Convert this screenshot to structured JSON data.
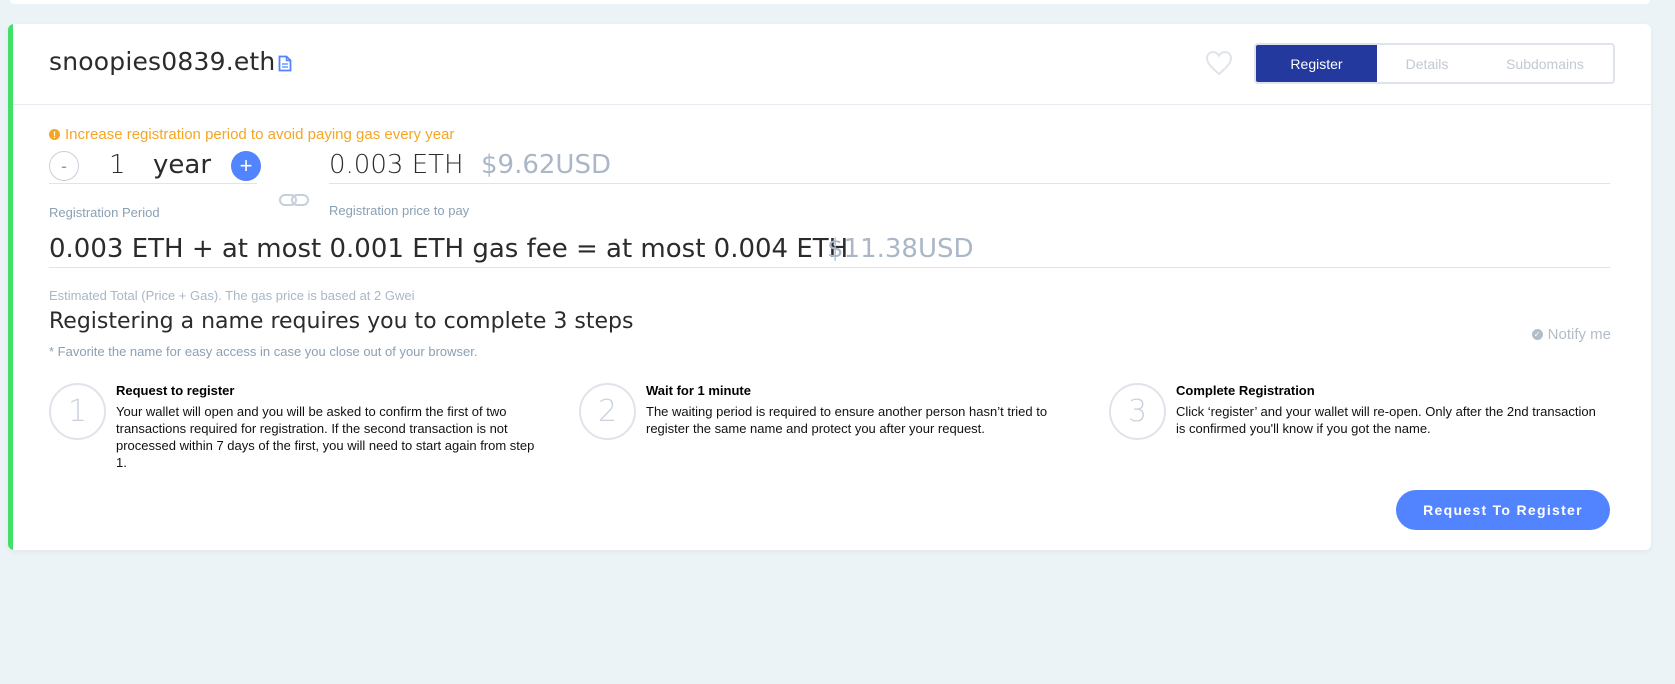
{
  "header": {
    "domain": "snoopies0839.eth",
    "tabs": [
      {
        "label": "Register",
        "active": true
      },
      {
        "label": "Details",
        "active": false
      },
      {
        "label": "Subdomains",
        "active": false
      }
    ]
  },
  "warning": "Increase registration period to avoid paying gas every year",
  "period": {
    "minus_label": "-",
    "value": "1",
    "unit": "year",
    "plus_label": "+",
    "label": "Registration Period"
  },
  "price": {
    "eth": "0.003 ETH",
    "usd": "$9.62USD",
    "label": "Registration price to pay"
  },
  "total": {
    "text": "0.003 ETH + at most 0.001 ETH gas fee = at most 0.004 ETH",
    "usd": "$11.38USD",
    "label": "Estimated Total (Price + Gas). The gas price is based at 2 Gwei"
  },
  "steps_section": {
    "title": "Registering a name requires you to complete 3 steps",
    "note": "* Favorite the name for easy access in case you close out of your browser.",
    "notify_label": "Notify me",
    "steps": [
      {
        "number": "1",
        "title": "Request to register",
        "description": "Your wallet will open and you will be asked to confirm the first of two transactions required for registration. If the second transaction is not processed within 7 days of the first, you will need to start again from step 1."
      },
      {
        "number": "2",
        "title": "Wait for 1 minute",
        "description": "The waiting period is required to ensure another person hasn’t tried to register the same name and protect you after your request."
      },
      {
        "number": "3",
        "title": "Complete Registration",
        "description": "Click ‘register’ and your wallet will re-open. Only after the 2nd transaction is confirmed you'll know if you got the name."
      }
    ]
  },
  "action": {
    "button_label": "Request To Register"
  },
  "colors": {
    "accent_green": "#42e068",
    "tab_active": "#23399e",
    "primary_blue": "#5284ff",
    "warning_orange": "#f5a623",
    "background": "#ecf3f6"
  },
  "icons": {
    "copy": "copy-icon",
    "favorite": "heart-icon",
    "link": "link-icon",
    "info": "info-icon",
    "check": "check-icon"
  }
}
